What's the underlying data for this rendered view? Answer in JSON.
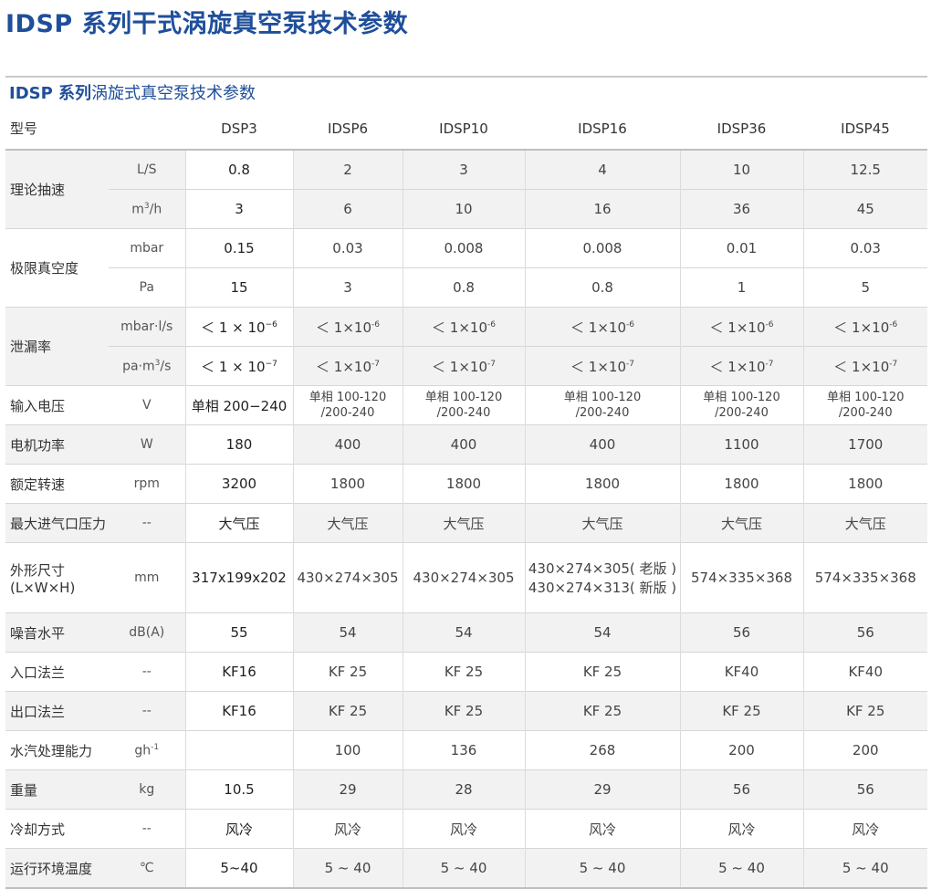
{
  "title": "IDSP 系列干式涡旋真空泵技术参数",
  "subtitle": {
    "bold": "IDSP 系列",
    "rest": "涡旋式真空泵技术参数"
  },
  "header": {
    "label": "型号",
    "models": [
      "DSP3",
      "IDSP6",
      "IDSP10",
      "IDSP16",
      "IDSP36",
      "IDSP45"
    ]
  },
  "rows": {
    "speed": {
      "label": "理论抽速",
      "ls": {
        "unit": "L/S",
        "values": [
          "0.8",
          "2",
          "3",
          "4",
          "10",
          "12.5"
        ]
      },
      "m3h": {
        "unit_base": "m",
        "unit_sup": "3",
        "unit_tail": "/h",
        "values": [
          "3",
          "6",
          "10",
          "16",
          "36",
          "45"
        ]
      }
    },
    "vacuum": {
      "label": "极限真空度",
      "mbar": {
        "unit": "mbar",
        "values": [
          "0.15",
          "0.03",
          "0.008",
          "0.008",
          "0.01",
          "0.03"
        ]
      },
      "pa": {
        "unit": "Pa",
        "values": [
          "15",
          "3",
          "0.8",
          "0.8",
          "1",
          "5"
        ]
      }
    },
    "leak": {
      "label": "泄漏率",
      "mbar": {
        "unit": "mbar·l/s",
        "base": [
          "＜ 1 × 10",
          "＜ 1×10",
          "＜ 1×10",
          "＜ 1×10",
          "＜ 1×10",
          "＜ 1×10"
        ],
        "exp": [
          "−6",
          "-6",
          "-6",
          "-6",
          "-6",
          "-6"
        ]
      },
      "pa": {
        "unit_base": "pa·m",
        "unit_sup": "3",
        "unit_tail": "/s",
        "base": [
          "＜ 1 × 10",
          "＜ 1×10",
          "＜ 1×10",
          "＜ 1×10",
          "＜ 1×10",
          "＜ 1×10"
        ],
        "exp": [
          "−7",
          "-7",
          "-7",
          "-7",
          "-7",
          "-7"
        ]
      }
    },
    "voltage": {
      "label": "输入电压",
      "unit": "V",
      "first": "单相 200−240",
      "line1": "单相 100-120",
      "line2": "/200-240"
    },
    "power": {
      "label": "电机功率",
      "unit": "W",
      "values": [
        "180",
        "400",
        "400",
        "400",
        "1100",
        "1700"
      ]
    },
    "rpm": {
      "label": "额定转速",
      "unit": "rpm",
      "values": [
        "3200",
        "1800",
        "1800",
        "1800",
        "1800",
        "1800"
      ]
    },
    "inlet_pressure": {
      "label": "最大进气口压力",
      "unit": "--",
      "values": [
        "大气压",
        "大气压",
        "大气压",
        "大气压",
        "大气压",
        "大气压"
      ]
    },
    "dimensions": {
      "label1": "外形尺寸",
      "label2": "(L×W×H)",
      "unit": "mm",
      "values": [
        "317x199x202",
        "430×274×305",
        "430×274×305",
        "",
        "574×335×368",
        "574×335×368"
      ],
      "idsp16_line1": "430×274×305( 老版 )",
      "idsp16_line2": "430×274×313( 新版 )"
    },
    "noise": {
      "label": "噪音水平",
      "unit": "dB(A)",
      "values": [
        "55",
        "54",
        "54",
        "54",
        "56",
        "56"
      ]
    },
    "inlet_flange": {
      "label": "入口法兰",
      "unit": "--",
      "values": [
        "KF16",
        "KF 25",
        "KF 25",
        "KF 25",
        "KF40",
        "KF40"
      ]
    },
    "outlet_flange": {
      "label": "出口法兰",
      "unit": "--",
      "values": [
        "KF16",
        "KF 25",
        "KF 25",
        "KF 25",
        "KF 25",
        "KF 25"
      ]
    },
    "water": {
      "label": "水汽处理能力",
      "unit_base": "gh",
      "unit_sup": "-1",
      "values": [
        "",
        "100",
        "136",
        "268",
        "200",
        "200"
      ]
    },
    "weight": {
      "label": "重量",
      "unit": "kg",
      "values": [
        "10.5",
        "29",
        "28",
        "29",
        "56",
        "56"
      ]
    },
    "cooling": {
      "label": "冷却方式",
      "unit": "--",
      "values": [
        "风冷",
        "风冷",
        "风冷",
        "风冷",
        "风冷",
        "风冷"
      ]
    },
    "temp": {
      "label": "运行环境温度",
      "unit": "℃",
      "values": [
        "5~40",
        "5 ~ 40",
        "5 ~ 40",
        "5 ~ 40",
        "5 ~ 40",
        "5 ~ 40"
      ]
    }
  }
}
